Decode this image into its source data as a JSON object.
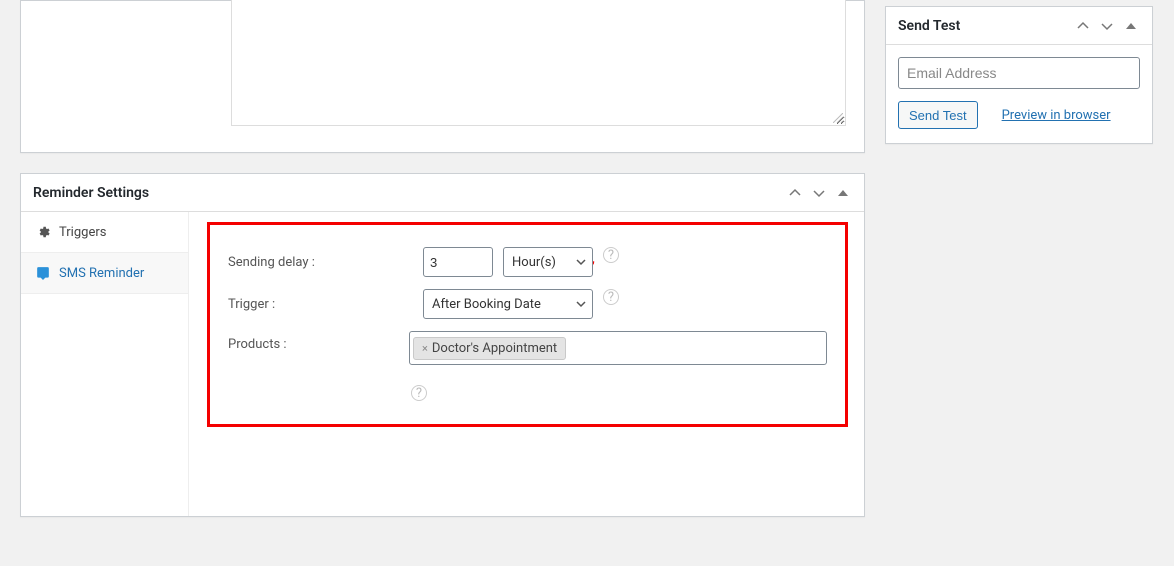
{
  "editor": {
    "content": ""
  },
  "reminder": {
    "title": "Reminder Settings",
    "tabs": {
      "triggers": "Triggers",
      "sms": "SMS Reminder"
    },
    "form": {
      "sending_delay_label": "Sending delay :",
      "sending_delay_value": "3",
      "sending_delay_unit": "Hour(s)",
      "trigger_label": "Trigger :",
      "trigger_value": "After Booking Date",
      "products_label": "Products :",
      "product_tag": "Doctor's Appointment"
    }
  },
  "sendtest": {
    "title": "Send Test",
    "placeholder": "Email Address",
    "button": "Send Test",
    "preview_link": "Preview in browser"
  }
}
